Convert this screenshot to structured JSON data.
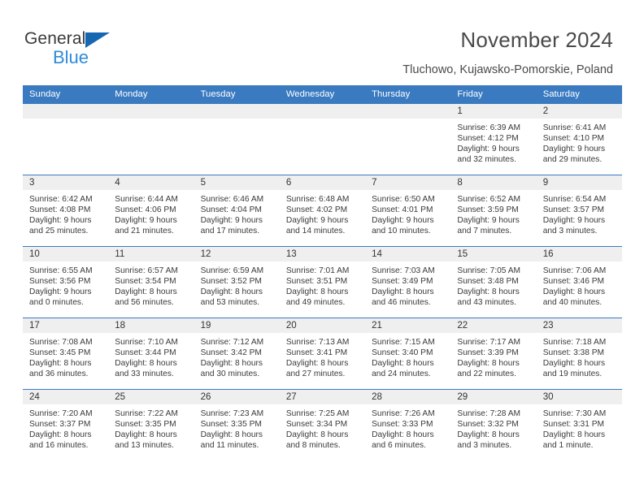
{
  "brand": {
    "name_top": "General",
    "name_bottom": "Blue",
    "triangle_color": "#1567b2",
    "blue_color": "#2e8bd8"
  },
  "header": {
    "title": "November 2024",
    "subtitle": "Tluchowo, Kujawsko-Pomorskie, Poland"
  },
  "theme": {
    "header_blue": "#3a7ac0",
    "daynum_gray": "#efefef",
    "text": "#3a3a3a"
  },
  "weekdays": [
    "Sunday",
    "Monday",
    "Tuesday",
    "Wednesday",
    "Thursday",
    "Friday",
    "Saturday"
  ],
  "weeks": [
    [
      {
        "day": "",
        "sunrise": "",
        "sunset": "",
        "daylight_line1": "",
        "daylight_line2": ""
      },
      {
        "day": "",
        "sunrise": "",
        "sunset": "",
        "daylight_line1": "",
        "daylight_line2": ""
      },
      {
        "day": "",
        "sunrise": "",
        "sunset": "",
        "daylight_line1": "",
        "daylight_line2": ""
      },
      {
        "day": "",
        "sunrise": "",
        "sunset": "",
        "daylight_line1": "",
        "daylight_line2": ""
      },
      {
        "day": "",
        "sunrise": "",
        "sunset": "",
        "daylight_line1": "",
        "daylight_line2": ""
      },
      {
        "day": "1",
        "sunrise": "Sunrise: 6:39 AM",
        "sunset": "Sunset: 4:12 PM",
        "daylight_line1": "Daylight: 9 hours",
        "daylight_line2": "and 32 minutes."
      },
      {
        "day": "2",
        "sunrise": "Sunrise: 6:41 AM",
        "sunset": "Sunset: 4:10 PM",
        "daylight_line1": "Daylight: 9 hours",
        "daylight_line2": "and 29 minutes."
      }
    ],
    [
      {
        "day": "3",
        "sunrise": "Sunrise: 6:42 AM",
        "sunset": "Sunset: 4:08 PM",
        "daylight_line1": "Daylight: 9 hours",
        "daylight_line2": "and 25 minutes."
      },
      {
        "day": "4",
        "sunrise": "Sunrise: 6:44 AM",
        "sunset": "Sunset: 4:06 PM",
        "daylight_line1": "Daylight: 9 hours",
        "daylight_line2": "and 21 minutes."
      },
      {
        "day": "5",
        "sunrise": "Sunrise: 6:46 AM",
        "sunset": "Sunset: 4:04 PM",
        "daylight_line1": "Daylight: 9 hours",
        "daylight_line2": "and 17 minutes."
      },
      {
        "day": "6",
        "sunrise": "Sunrise: 6:48 AM",
        "sunset": "Sunset: 4:02 PM",
        "daylight_line1": "Daylight: 9 hours",
        "daylight_line2": "and 14 minutes."
      },
      {
        "day": "7",
        "sunrise": "Sunrise: 6:50 AM",
        "sunset": "Sunset: 4:01 PM",
        "daylight_line1": "Daylight: 9 hours",
        "daylight_line2": "and 10 minutes."
      },
      {
        "day": "8",
        "sunrise": "Sunrise: 6:52 AM",
        "sunset": "Sunset: 3:59 PM",
        "daylight_line1": "Daylight: 9 hours",
        "daylight_line2": "and 7 minutes."
      },
      {
        "day": "9",
        "sunrise": "Sunrise: 6:54 AM",
        "sunset": "Sunset: 3:57 PM",
        "daylight_line1": "Daylight: 9 hours",
        "daylight_line2": "and 3 minutes."
      }
    ],
    [
      {
        "day": "10",
        "sunrise": "Sunrise: 6:55 AM",
        "sunset": "Sunset: 3:56 PM",
        "daylight_line1": "Daylight: 9 hours",
        "daylight_line2": "and 0 minutes."
      },
      {
        "day": "11",
        "sunrise": "Sunrise: 6:57 AM",
        "sunset": "Sunset: 3:54 PM",
        "daylight_line1": "Daylight: 8 hours",
        "daylight_line2": "and 56 minutes."
      },
      {
        "day": "12",
        "sunrise": "Sunrise: 6:59 AM",
        "sunset": "Sunset: 3:52 PM",
        "daylight_line1": "Daylight: 8 hours",
        "daylight_line2": "and 53 minutes."
      },
      {
        "day": "13",
        "sunrise": "Sunrise: 7:01 AM",
        "sunset": "Sunset: 3:51 PM",
        "daylight_line1": "Daylight: 8 hours",
        "daylight_line2": "and 49 minutes."
      },
      {
        "day": "14",
        "sunrise": "Sunrise: 7:03 AM",
        "sunset": "Sunset: 3:49 PM",
        "daylight_line1": "Daylight: 8 hours",
        "daylight_line2": "and 46 minutes."
      },
      {
        "day": "15",
        "sunrise": "Sunrise: 7:05 AM",
        "sunset": "Sunset: 3:48 PM",
        "daylight_line1": "Daylight: 8 hours",
        "daylight_line2": "and 43 minutes."
      },
      {
        "day": "16",
        "sunrise": "Sunrise: 7:06 AM",
        "sunset": "Sunset: 3:46 PM",
        "daylight_line1": "Daylight: 8 hours",
        "daylight_line2": "and 40 minutes."
      }
    ],
    [
      {
        "day": "17",
        "sunrise": "Sunrise: 7:08 AM",
        "sunset": "Sunset: 3:45 PM",
        "daylight_line1": "Daylight: 8 hours",
        "daylight_line2": "and 36 minutes."
      },
      {
        "day": "18",
        "sunrise": "Sunrise: 7:10 AM",
        "sunset": "Sunset: 3:44 PM",
        "daylight_line1": "Daylight: 8 hours",
        "daylight_line2": "and 33 minutes."
      },
      {
        "day": "19",
        "sunrise": "Sunrise: 7:12 AM",
        "sunset": "Sunset: 3:42 PM",
        "daylight_line1": "Daylight: 8 hours",
        "daylight_line2": "and 30 minutes."
      },
      {
        "day": "20",
        "sunrise": "Sunrise: 7:13 AM",
        "sunset": "Sunset: 3:41 PM",
        "daylight_line1": "Daylight: 8 hours",
        "daylight_line2": "and 27 minutes."
      },
      {
        "day": "21",
        "sunrise": "Sunrise: 7:15 AM",
        "sunset": "Sunset: 3:40 PM",
        "daylight_line1": "Daylight: 8 hours",
        "daylight_line2": "and 24 minutes."
      },
      {
        "day": "22",
        "sunrise": "Sunrise: 7:17 AM",
        "sunset": "Sunset: 3:39 PM",
        "daylight_line1": "Daylight: 8 hours",
        "daylight_line2": "and 22 minutes."
      },
      {
        "day": "23",
        "sunrise": "Sunrise: 7:18 AM",
        "sunset": "Sunset: 3:38 PM",
        "daylight_line1": "Daylight: 8 hours",
        "daylight_line2": "and 19 minutes."
      }
    ],
    [
      {
        "day": "24",
        "sunrise": "Sunrise: 7:20 AM",
        "sunset": "Sunset: 3:37 PM",
        "daylight_line1": "Daylight: 8 hours",
        "daylight_line2": "and 16 minutes."
      },
      {
        "day": "25",
        "sunrise": "Sunrise: 7:22 AM",
        "sunset": "Sunset: 3:35 PM",
        "daylight_line1": "Daylight: 8 hours",
        "daylight_line2": "and 13 minutes."
      },
      {
        "day": "26",
        "sunrise": "Sunrise: 7:23 AM",
        "sunset": "Sunset: 3:35 PM",
        "daylight_line1": "Daylight: 8 hours",
        "daylight_line2": "and 11 minutes."
      },
      {
        "day": "27",
        "sunrise": "Sunrise: 7:25 AM",
        "sunset": "Sunset: 3:34 PM",
        "daylight_line1": "Daylight: 8 hours",
        "daylight_line2": "and 8 minutes."
      },
      {
        "day": "28",
        "sunrise": "Sunrise: 7:26 AM",
        "sunset": "Sunset: 3:33 PM",
        "daylight_line1": "Daylight: 8 hours",
        "daylight_line2": "and 6 minutes."
      },
      {
        "day": "29",
        "sunrise": "Sunrise: 7:28 AM",
        "sunset": "Sunset: 3:32 PM",
        "daylight_line1": "Daylight: 8 hours",
        "daylight_line2": "and 3 minutes."
      },
      {
        "day": "30",
        "sunrise": "Sunrise: 7:30 AM",
        "sunset": "Sunset: 3:31 PM",
        "daylight_line1": "Daylight: 8 hours",
        "daylight_line2": "and 1 minute."
      }
    ]
  ]
}
